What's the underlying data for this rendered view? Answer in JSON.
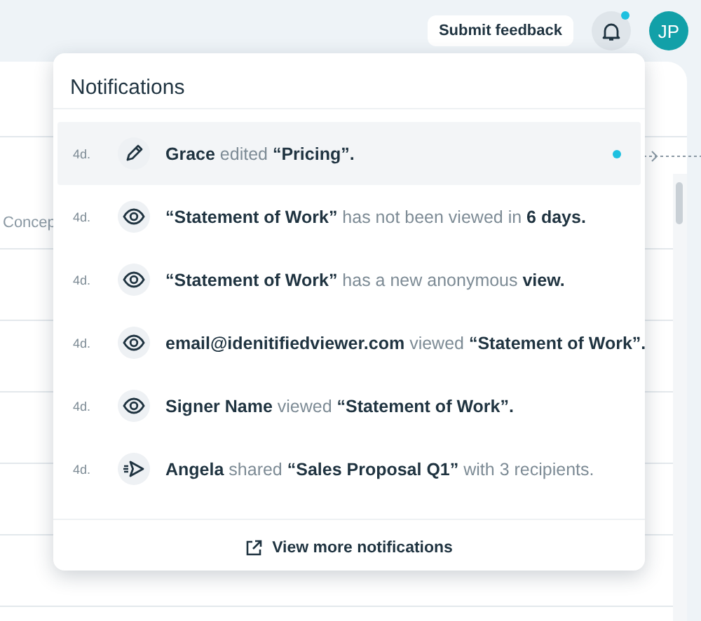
{
  "top_bar": {
    "feedback_button": "Submit feedback",
    "bell_has_new": true,
    "avatar_initials": "JP"
  },
  "table": {
    "rows": [
      {
        "column_1": "Concep"
      }
    ]
  },
  "notifications_panel": {
    "title": "Notifications",
    "notifications": [
      {
        "age": "4d.",
        "kind": "edit",
        "message": "**Grace** edited **“Pricing”.**",
        "unread": true,
        "highlighted": true
      },
      {
        "age": "4d.",
        "kind": "view",
        "message": "**“Statement of Work”** has not been viewed in **6 days.**",
        "unread": false,
        "highlighted": false
      },
      {
        "age": "4d.",
        "kind": "view",
        "message": "**“Statement of Work”** has a new anonymous **view.**",
        "unread": false,
        "highlighted": false
      },
      {
        "age": "4d.",
        "kind": "view",
        "message": "**email@idenitifiedviewer.com** viewed **“Statement of Work”.**",
        "unread": false,
        "highlighted": false
      },
      {
        "age": "4d.",
        "kind": "view",
        "message": "**Signer Name** viewed **“Statement of Work”.**",
        "unread": false,
        "highlighted": false
      },
      {
        "age": "4d.",
        "kind": "share",
        "message": "**Angela** shared **“Sales Proposal Q1”** with 3 recipients.",
        "unread": false,
        "highlighted": false
      }
    ],
    "footer_link": "View more notifications"
  }
}
